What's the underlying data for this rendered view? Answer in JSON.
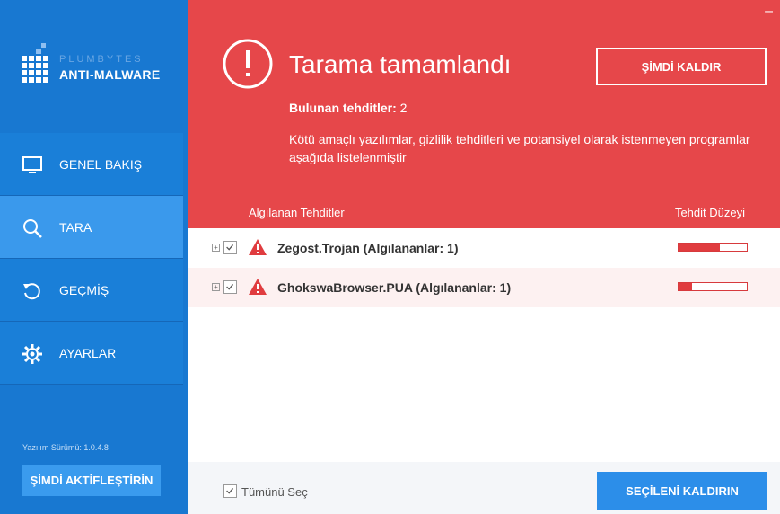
{
  "brand": {
    "company": "PLUMBYTES",
    "product": "ANTI-MALWARE"
  },
  "sidebar": {
    "items": [
      {
        "label": "GENEL BAKIŞ",
        "icon": "monitor-icon"
      },
      {
        "label": "TARA",
        "icon": "search-icon",
        "active": true
      },
      {
        "label": "GEÇMİŞ",
        "icon": "history-icon"
      },
      {
        "label": "AYARLAR",
        "icon": "gear-icon"
      }
    ],
    "version_label": "Yazılım Sürümü:",
    "version_value": "1.0.4.8",
    "activate_label": "ŞİMDİ AKTİFLEŞTİRİN"
  },
  "header": {
    "title": "Tarama tamamlandı",
    "found_label": "Bulunan tehditler:",
    "found_count": "2",
    "description": "Kötü amaçlı yazılımlar, gizlilik tehditleri ve potansiyel olarak istenmeyen programlar aşağıda listelenmiştir",
    "remove_now_label": "ŞİMDİ KALDIR",
    "minimize_symbol": "–"
  },
  "table": {
    "col_threats": "Algılanan Tehditler",
    "col_level": "Tehdit Düzeyi",
    "rows": [
      {
        "name": "Zegost.Trojan",
        "detected": "(Algılananlar: 1)",
        "level": 0.6,
        "checked": true
      },
      {
        "name": "GhokswaBrowser.PUA",
        "detected": "(Algılananlar: 1)",
        "level": 0.2,
        "checked": true
      }
    ]
  },
  "footer": {
    "select_all_label": "Tümünü Seç",
    "remove_selected_label": "SEÇİLENİ KALDIRIN"
  },
  "colors": {
    "sidebar": "#1878d1",
    "active_nav": "#3a99ec",
    "header_red": "#e6474a",
    "primary_button": "#2c8ee9"
  }
}
